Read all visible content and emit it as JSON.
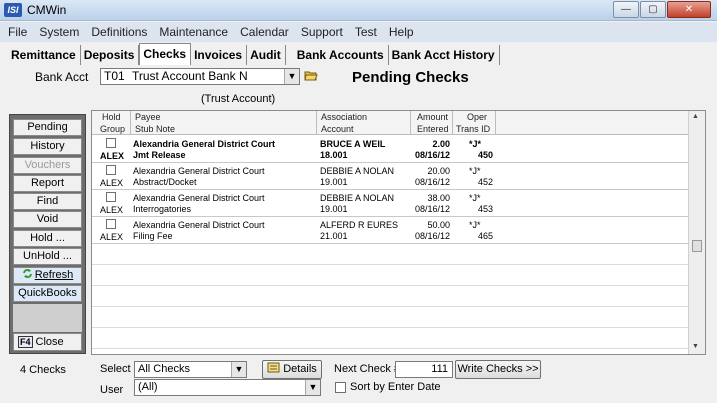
{
  "window": {
    "title": "CMWin",
    "app_icon_text": "ISI",
    "minimize": "—",
    "maximize": "▢",
    "close": "✕"
  },
  "menu": [
    "File",
    "System",
    "Definitions",
    "Maintenance",
    "Calendar",
    "Support",
    "Test",
    "Help"
  ],
  "tabs": [
    {
      "label": "Remittance",
      "active": false
    },
    {
      "label": "Deposits",
      "active": false
    },
    {
      "label": "Checks",
      "active": true
    },
    {
      "label": "Invoices",
      "active": false
    },
    {
      "label": "Audit",
      "active": false
    },
    {
      "label": "Bank Accounts",
      "active": false
    },
    {
      "label": "Bank Acct History",
      "active": false
    }
  ],
  "bank": {
    "label": "Bank Acct",
    "code": "T01",
    "name": "Trust Account Bank N",
    "account_type": "(Trust Account)"
  },
  "page_title": "Pending Checks",
  "nav": {
    "pending": "Pending",
    "history": "History",
    "vouchers": "Vouchers",
    "report": "Report",
    "find": "Find",
    "void": "Void",
    "hold": "Hold ...",
    "unhold": "UnHold ...",
    "refresh": "Refresh",
    "quickbooks": "QuickBooks",
    "close_key": "F4",
    "close": "Close"
  },
  "grid": {
    "headers": {
      "hold": "Hold",
      "group": "Group",
      "payee": "Payee",
      "stub_note": "Stub Note",
      "association": "Association",
      "account": "Account",
      "amount": "Amount",
      "entered": "Entered",
      "oper": "Oper",
      "trans_id": "Trans ID"
    },
    "rows": [
      {
        "group": "ALEX",
        "payee": "Alexandria General District Court",
        "stub": "Jmt Release",
        "assoc": "BRUCE A WEIL",
        "account": "18.001",
        "amount": "2.00",
        "entered": "08/16/12",
        "oper": "*J*",
        "trans": "450",
        "selected": true
      },
      {
        "group": "ALEX",
        "payee": "Alexandria General District Court",
        "stub": "Abstract/Docket",
        "assoc": "DEBBIE A NOLAN",
        "account": "19.001",
        "amount": "20.00",
        "entered": "08/16/12",
        "oper": "*J*",
        "trans": "452",
        "selected": false
      },
      {
        "group": "ALEX",
        "payee": "Alexandria General District Court",
        "stub": "Interrogatories",
        "assoc": "DEBBIE A NOLAN",
        "account": "19.001",
        "amount": "38.00",
        "entered": "08/16/12",
        "oper": "*J*",
        "trans": "453",
        "selected": false
      },
      {
        "group": "ALEX",
        "payee": "Alexandria General District Court",
        "stub": "Filing Fee",
        "assoc": "ALFERD R EURES",
        "account": "21.001",
        "amount": "50.00",
        "entered": "08/16/12",
        "oper": "*J*",
        "trans": "465",
        "selected": false
      }
    ]
  },
  "footer": {
    "count": "4 Checks",
    "select_label": "Select",
    "select_value": "All Checks",
    "details": "Details",
    "next_check_label": "Next Check #",
    "next_check": "111",
    "write_checks": "Write Checks >>",
    "user_label": "User",
    "user_value": "(All)",
    "sort_label": "Sort by Enter Date"
  }
}
